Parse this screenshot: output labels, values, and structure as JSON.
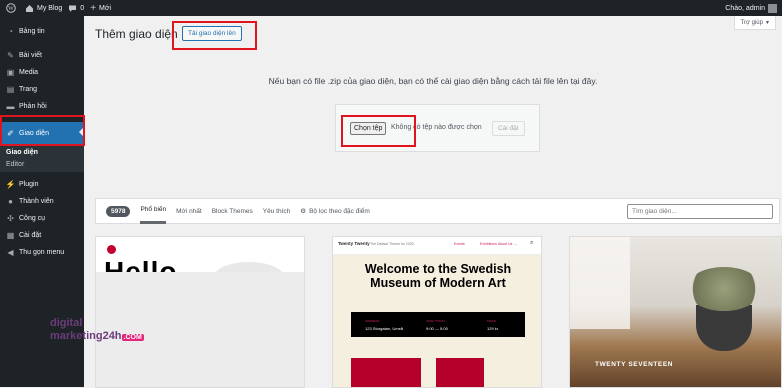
{
  "adminbar": {
    "site": "My Blog",
    "comments": "0",
    "new": "Mới",
    "greeting": "Chào, admin"
  },
  "sidebar": {
    "items": [
      {
        "label": "Bảng tin",
        "icon": "dashboard-icon"
      },
      {
        "label": "Bài viết",
        "icon": "pin-icon"
      },
      {
        "label": "Media",
        "icon": "media-icon"
      },
      {
        "label": "Trang",
        "icon": "page-icon"
      },
      {
        "label": "Phản hồi",
        "icon": "comment-icon"
      },
      {
        "label": "Giao diện",
        "icon": "brush-icon"
      }
    ],
    "submenu": [
      "Giao diện",
      "Editor"
    ],
    "items2": [
      {
        "label": "Plugin",
        "icon": "plugin-icon"
      },
      {
        "label": "Thành viên",
        "icon": "users-icon"
      },
      {
        "label": "Công cụ",
        "icon": "tools-icon"
      },
      {
        "label": "Cài đặt",
        "icon": "settings-icon"
      },
      {
        "label": "Thu gọn menu",
        "icon": "collapse-icon"
      }
    ]
  },
  "main": {
    "title": "Thêm giao diện",
    "upload_label": "Tải giao diện lên",
    "help": "Trợ giúp",
    "help_text": "Nếu bạn có file .zip của giao diện, bạn có thể cài giao diện bằng cách tải file lên tại đây.",
    "choose_file": "Chọn tệp",
    "no_file": "Không có tệp nào được chọn",
    "install": "Cài đặt"
  },
  "filter": {
    "count": "5978",
    "tabs": [
      "Phổ biến",
      "Mới nhất",
      "Block Themes",
      "Yêu thích"
    ],
    "feature_filter": "Bộ lọc theo đặc điểm",
    "search_placeholder": "Tìm giao diện..."
  },
  "themes": {
    "t1": {
      "hero": "Hello"
    },
    "t2": {
      "brand": "Twenty Twenty",
      "tagline": "The Default Theme for 2020",
      "nav": [
        "Events",
        "Exhibitions",
        "About Us",
        "..."
      ],
      "headline": "Welcome to the Swedish Museum of Modern Art",
      "info": [
        {
          "label": "ADDRESS",
          "value": "123 Storgatan, Umeå"
        },
        {
          "label": "OPEN TODAY",
          "value": "9:00 — 5:00"
        },
        {
          "label": "PRICE",
          "value": "129 kr"
        }
      ]
    },
    "t3": {
      "name": "TWENTY SEVENTEEN"
    }
  },
  "watermark": {
    "line1": "digital",
    "line2": "marketing24h",
    "com": ".COM"
  }
}
